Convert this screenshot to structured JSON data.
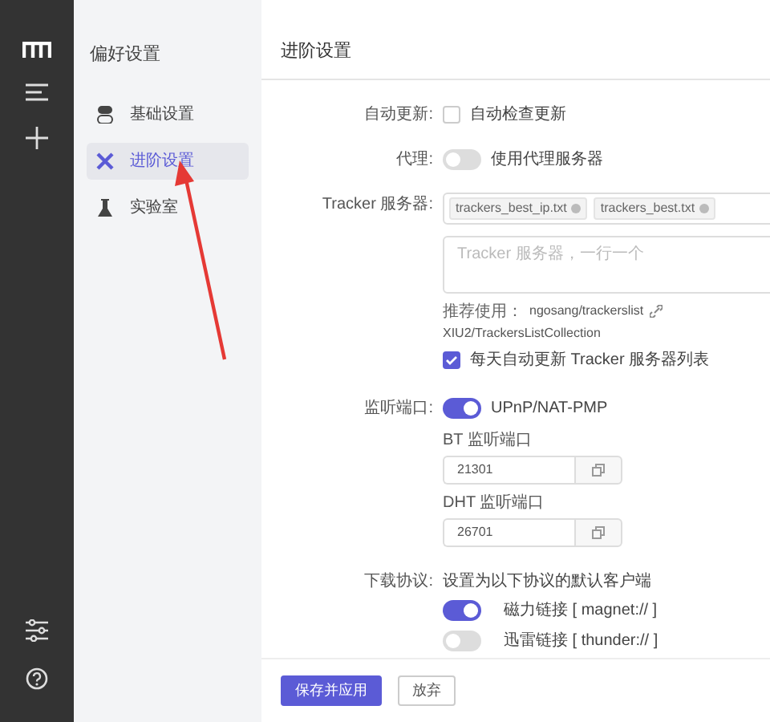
{
  "sidebar": {
    "title": "偏好设置",
    "items": [
      {
        "label": "基础设置",
        "selected": false,
        "kind": "basic"
      },
      {
        "label": "进阶设置",
        "selected": true,
        "kind": "advanced"
      },
      {
        "label": "实验室",
        "selected": false,
        "kind": "lab"
      }
    ]
  },
  "page": {
    "title": "进阶设置"
  },
  "auto_update": {
    "label": "自动更新:",
    "option": "自动检查更新",
    "checked": false
  },
  "proxy": {
    "label": "代理:",
    "option": "使用代理服务器",
    "on": false
  },
  "tracker": {
    "label": "Tracker 服务器:",
    "tags": [
      "trackers_best_ip.txt",
      "trackers_best.txt"
    ],
    "placeholder": "Tracker 服务器，一行一个",
    "recommend_label": "推荐使用：",
    "links": [
      "ngosang/trackerslist",
      "XIU2/TrackersListCollection"
    ],
    "daily_option": "每天自动更新 Tracker 服务器列表",
    "daily_checked": true
  },
  "listen_port": {
    "label": "监听端口:",
    "upnp": "UPnP/NAT-PMP",
    "upnp_on": true,
    "fields": [
      {
        "label": "BT 监听端口",
        "value": "21301"
      },
      {
        "label": "DHT 监听端口",
        "value": "26701"
      }
    ]
  },
  "protocols": {
    "label": "下载协议:",
    "hint": "设置为以下协议的默认客户端",
    "items": [
      {
        "label": "磁力链接 [ magnet:// ]",
        "on": true
      },
      {
        "label": "迅雷链接 [ thunder:// ]",
        "on": false
      }
    ]
  },
  "buttons": [
    {
      "label": "保存并应用",
      "kind": "primary"
    },
    {
      "label": "放弃",
      "kind": "secondary"
    }
  ]
}
